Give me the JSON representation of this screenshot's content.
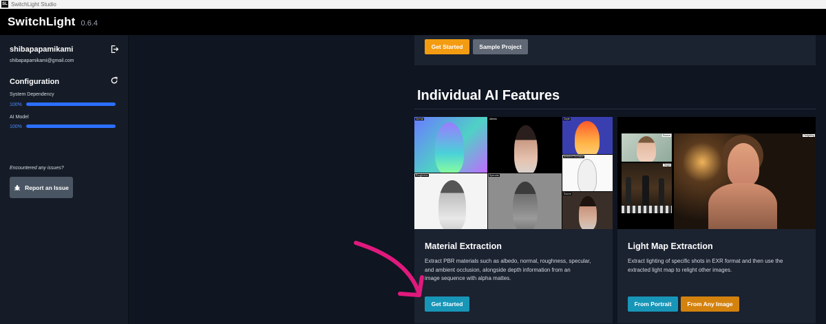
{
  "window": {
    "title": "SwitchLight Studio",
    "logo_text": "SL"
  },
  "app": {
    "name": "SwitchLight",
    "version": "0.6.4"
  },
  "sidebar": {
    "username": "shibapapamikami",
    "email": "shibapapamikami@gmail.com",
    "config_title": "Configuration",
    "dependencies": [
      {
        "label": "System Dependency",
        "percent": "100%",
        "progress": 1.0
      },
      {
        "label": "AI Model",
        "percent": "100%",
        "progress": 1.0
      }
    ],
    "issue_prompt": "Encountered any issues?",
    "report_button": "Report an Issue"
  },
  "top_panel": {
    "get_started": "Get Started",
    "sample_project": "Sample Project"
  },
  "section": {
    "title": "Individual AI Features"
  },
  "cards": [
    {
      "title": "Material Extraction",
      "description_lines": [
        "Extract PBR materials such as albedo, normal, roughness, specular,",
        "and ambient occlusion, alongside depth information from an",
        "image sequence with alpha mattes."
      ],
      "button": "Get Started",
      "tile_labels": [
        "Normal",
        "Albedo",
        "Depth",
        "Ambient Occlusion",
        "Roughness",
        "Specular",
        "Source"
      ]
    },
    {
      "title": "Light Map Extraction",
      "description_lines": [
        "Extract lighting of specific shots in EXR format and then use the",
        "extracted light map to relight other images."
      ],
      "buttons": [
        "From Portrait",
        "From Any Image"
      ],
      "tile_labels": [
        "Source",
        "Target",
        "Relighting"
      ]
    }
  ],
  "colors": {
    "accent_orange": "#f39c12",
    "accent_teal": "#1796b8",
    "progress_blue": "#2b6fff",
    "annotation_arrow": "#e0197d"
  }
}
